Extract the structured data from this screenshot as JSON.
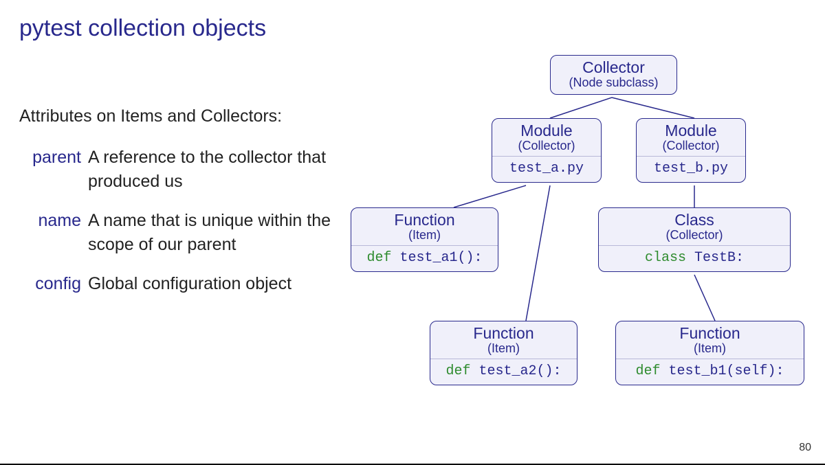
{
  "title": "pytest collection objects",
  "attrs": {
    "heading": "Attributes on Items and Collectors:",
    "list": [
      {
        "term": "parent",
        "desc": "A reference to the collector that produced us"
      },
      {
        "term": "name",
        "desc": "A name that is unique within the scope of our parent"
      },
      {
        "term": "config",
        "desc": "Global configuration object"
      }
    ]
  },
  "diagram": {
    "collector": {
      "title": "Collector",
      "sub": "(Node subclass)"
    },
    "module_a": {
      "title": "Module",
      "sub": "(Collector)",
      "code_plain": "test_a.py"
    },
    "module_b": {
      "title": "Module",
      "sub": "(Collector)",
      "code_plain": "test_b.py"
    },
    "func_a1": {
      "title": "Function",
      "sub": "(Item)",
      "kw": "def",
      "rest": " test_a1():"
    },
    "func_a2": {
      "title": "Function",
      "sub": "(Item)",
      "kw": "def",
      "rest": " test_a2():"
    },
    "class_b": {
      "title": "Class",
      "sub": "(Collector)",
      "kw": "class",
      "rest": " TestB:"
    },
    "func_b1": {
      "title": "Function",
      "sub": "(Item)",
      "kw": "def",
      "rest": " test_b1(self):"
    }
  },
  "page_number": "80"
}
